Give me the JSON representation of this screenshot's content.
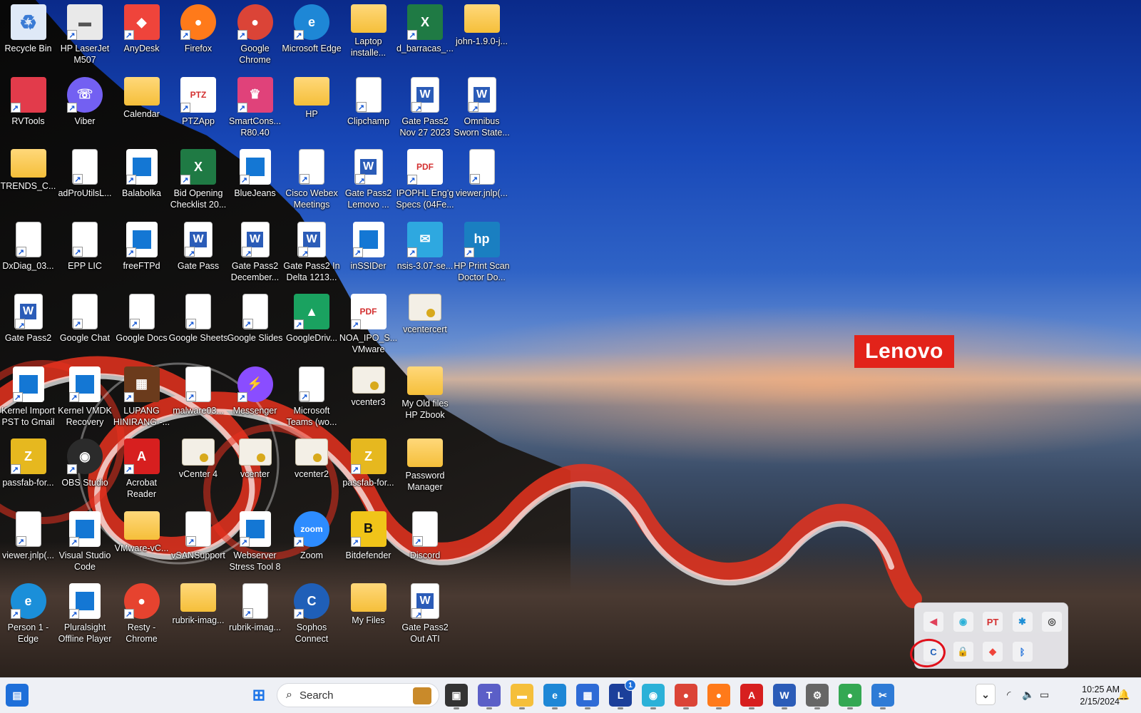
{
  "desktop": {
    "brand_logo": "Lenovo",
    "icons": [
      {
        "label": "Recycle Bin",
        "kind": "recycle",
        "color": "#dfe9f7"
      },
      {
        "label": "RVTools",
        "kind": "tile",
        "color": "#e23b4b"
      },
      {
        "label": "TRENDS_C...",
        "kind": "folder"
      },
      {
        "label": "DxDiag_03...",
        "kind": "doc"
      },
      {
        "label": "Gate Pass2",
        "kind": "word"
      },
      {
        "label": "Kernel Import PST to Gmail",
        "kind": "app"
      },
      {
        "label": "passfab-for...",
        "kind": "tile",
        "color": "#e6b81f",
        "glyph": "Z"
      },
      {
        "label": "viewer.jnlp(...",
        "kind": "doc"
      },
      {
        "label": "Person 1 - Edge",
        "kind": "round",
        "color": "#1b8fd9",
        "glyph": "e"
      },
      {
        "label": "HP LaserJet M507",
        "kind": "tile",
        "color": "#e9e9e9",
        "glyph": "▬",
        "ink": "#555"
      },
      {
        "label": "Viber",
        "kind": "round",
        "color": "#7360f2",
        "glyph": "☏"
      },
      {
        "label": "adProUtilsL...",
        "kind": "doc"
      },
      {
        "label": "EPP LIC",
        "kind": "doc"
      },
      {
        "label": "Google Chat",
        "kind": "doc"
      },
      {
        "label": "Kernel VMDK Recovery",
        "kind": "app"
      },
      {
        "label": "OBS Studio",
        "kind": "round",
        "color": "#2b2b2b",
        "glyph": "◉"
      },
      {
        "label": "Visual Studio Code",
        "kind": "app"
      },
      {
        "label": "Pluralsight Offline Player",
        "kind": "app"
      },
      {
        "label": "AnyDesk",
        "kind": "tile",
        "color": "#ef443b",
        "glyph": "◆"
      },
      {
        "label": "Calendar",
        "kind": "folder"
      },
      {
        "label": "Balabolka",
        "kind": "app"
      },
      {
        "label": "freeFTPd",
        "kind": "app"
      },
      {
        "label": "Google Docs",
        "kind": "doc"
      },
      {
        "label": "LUPANG HINIRANG -...",
        "kind": "tile",
        "color": "#6b3b1c",
        "glyph": "▦"
      },
      {
        "label": "Acrobat Reader",
        "kind": "tile",
        "color": "#d71f1f",
        "glyph": "A"
      },
      {
        "label": "VMware-vC...",
        "kind": "folder"
      },
      {
        "label": "Resty - Chrome",
        "kind": "round",
        "color": "#e6432f",
        "glyph": "●"
      },
      {
        "label": "Firefox",
        "kind": "round",
        "color": "#ff7a1a",
        "glyph": "●"
      },
      {
        "label": "PTZApp",
        "kind": "tile",
        "color": "#ffffff",
        "glyph": "PTZ",
        "ink": "#d32f2f"
      },
      {
        "label": "Bid Opening Checklist 20...",
        "kind": "tile",
        "color": "#1f7a44",
        "glyph": "X"
      },
      {
        "label": "Gate Pass",
        "kind": "word"
      },
      {
        "label": "Google Sheets",
        "kind": "doc"
      },
      {
        "label": "malware03...",
        "kind": "doc"
      },
      {
        "label": "vCenter 4",
        "kind": "cert"
      },
      {
        "label": "vSANSupport",
        "kind": "doc"
      },
      {
        "label": "rubrik-imag...",
        "kind": "folder"
      },
      {
        "label": "Google Chrome",
        "kind": "round",
        "color": "#db4437",
        "glyph": "●"
      },
      {
        "label": "SmartCons... R80.40",
        "kind": "tile",
        "color": "#e0427a",
        "glyph": "♛"
      },
      {
        "label": "BlueJeans",
        "kind": "app"
      },
      {
        "label": "Gate Pass2 December...",
        "kind": "word"
      },
      {
        "label": "Google Slides",
        "kind": "doc"
      },
      {
        "label": "Messenger",
        "kind": "round",
        "color": "#8a4dff",
        "glyph": "⚡"
      },
      {
        "label": "vcenter",
        "kind": "cert"
      },
      {
        "label": "Webserver Stress Tool 8",
        "kind": "app"
      },
      {
        "label": "rubrik-imag...",
        "kind": "doc"
      },
      {
        "label": "Microsoft Edge",
        "kind": "round",
        "color": "#1e87d6",
        "glyph": "e"
      },
      {
        "label": "HP",
        "kind": "folder"
      },
      {
        "label": "Cisco Webex Meetings",
        "kind": "doc"
      },
      {
        "label": "Gate Pass2 In Delta 1213...",
        "kind": "word"
      },
      {
        "label": "GoogleDriv...",
        "kind": "tile",
        "color": "#1aa260",
        "glyph": "▲"
      },
      {
        "label": "Microsoft Teams (wo...",
        "kind": "doc"
      },
      {
        "label": "vcenter2",
        "kind": "cert"
      },
      {
        "label": "Zoom",
        "kind": "round",
        "color": "#2d8cff",
        "glyph": "zoom"
      },
      {
        "label": "Sophos Connect",
        "kind": "round",
        "color": "#1f5fb8",
        "glyph": "C"
      },
      {
        "label": "Laptop installe...",
        "kind": "folder"
      },
      {
        "label": "Clipchamp",
        "kind": "doc"
      },
      {
        "label": "Gate Pass2 Lemovo ...",
        "kind": "word"
      },
      {
        "label": "inSSIDer",
        "kind": "app"
      },
      {
        "label": "NOA_IPO_S... VMware",
        "kind": "tile",
        "color": "#ffffff",
        "glyph": "PDF",
        "ink": "#d32f2f"
      },
      {
        "label": "vcenter3",
        "kind": "cert"
      },
      {
        "label": "passfab-for...",
        "kind": "tile",
        "color": "#e6b81f",
        "glyph": "Z"
      },
      {
        "label": "Bitdefender",
        "kind": "tile",
        "color": "#f0c419",
        "glyph": "B",
        "ink": "#111"
      },
      {
        "label": "My Files",
        "kind": "folder"
      },
      {
        "label": "d_barracas_...",
        "kind": "tile",
        "color": "#1f7a44",
        "glyph": "X"
      },
      {
        "label": "Gate Pass2 Nov 27 2023",
        "kind": "word"
      },
      {
        "label": "IPOPHL Eng'g Specs (04Fe...",
        "kind": "tile",
        "color": "#ffffff",
        "glyph": "PDF",
        "ink": "#d32f2f"
      },
      {
        "label": "nsis-3.07-se...",
        "kind": "tile",
        "color": "#2ea8e0",
        "glyph": "✉"
      },
      {
        "label": "vcentercert",
        "kind": "cert"
      },
      {
        "label": "My Old files HP Zbook",
        "kind": "folder"
      },
      {
        "label": "Password Manager",
        "kind": "folder"
      },
      {
        "label": "Discord",
        "kind": "doc"
      },
      {
        "label": "Gate Pass2 Out ATI",
        "kind": "word"
      },
      {
        "label": "john-1.9.0-j...",
        "kind": "folder"
      },
      {
        "label": "Omnibus Sworn State...",
        "kind": "word"
      },
      {
        "label": "viewer.jnlp(...",
        "kind": "doc"
      },
      {
        "label": "HP Print Scan Doctor Do...",
        "kind": "tile",
        "color": "#1a7fc1",
        "glyph": "hp"
      }
    ]
  },
  "tray_popup": {
    "items": [
      {
        "name": "tray-red-app-icon",
        "glyph": "◀",
        "color": "#e0415a"
      },
      {
        "name": "tray-teal-app-icon",
        "glyph": "◉",
        "color": "#2bb1d8"
      },
      {
        "name": "tray-ptz-icon",
        "glyph": "PT",
        "color": "#d33030"
      },
      {
        "name": "tray-settings-app-icon",
        "glyph": "✱",
        "color": "#1e8ed6"
      },
      {
        "name": "tray-webcam-icon",
        "glyph": "◎",
        "color": "#444"
      },
      {
        "name": "tray-sophos-connect-icon",
        "glyph": "C",
        "color": "#1f5fb8"
      },
      {
        "name": "tray-lock-icon",
        "glyph": "🔒",
        "color": "#777"
      },
      {
        "name": "tray-anydesk-icon",
        "glyph": "◆",
        "color": "#ef443b"
      },
      {
        "name": "tray-bluetooth-icon",
        "glyph": "ᛒ",
        "color": "#1e6fd9"
      }
    ]
  },
  "taskbar": {
    "search_text": "Search",
    "apps": [
      {
        "name": "task-view-icon",
        "glyph": "▣",
        "color": "#333"
      },
      {
        "name": "teams-icon",
        "glyph": "T",
        "color": "#5b5fc7"
      },
      {
        "name": "file-explorer-icon",
        "glyph": "▬",
        "color": "#f5bf3a"
      },
      {
        "name": "edge-icon",
        "glyph": "e",
        "color": "#1e87d6"
      },
      {
        "name": "store-icon",
        "glyph": "▦",
        "color": "#2e6bd6"
      },
      {
        "name": "lenovo-vantage-icon",
        "glyph": "L",
        "color": "#1c3f9a"
      },
      {
        "name": "app-teal-icon",
        "glyph": "◉",
        "color": "#2bb1d8"
      },
      {
        "name": "chrome-icon",
        "glyph": "●",
        "color": "#db4437"
      },
      {
        "name": "firefox-icon",
        "glyph": "●",
        "color": "#ff7a1a"
      },
      {
        "name": "acrobat-icon",
        "glyph": "A",
        "color": "#d71f1f"
      },
      {
        "name": "word-icon",
        "glyph": "W",
        "color": "#2b5cb8"
      },
      {
        "name": "settings-icon",
        "glyph": "⚙",
        "color": "#666"
      },
      {
        "name": "chrome-profile-icon",
        "glyph": "●",
        "color": "#34a853"
      },
      {
        "name": "snipping-tool-icon",
        "glyph": "✂",
        "color": "#2e7bd6"
      }
    ],
    "badge_count": "1",
    "clock_time": "10:25 AM",
    "clock_date": "2/15/2024"
  }
}
